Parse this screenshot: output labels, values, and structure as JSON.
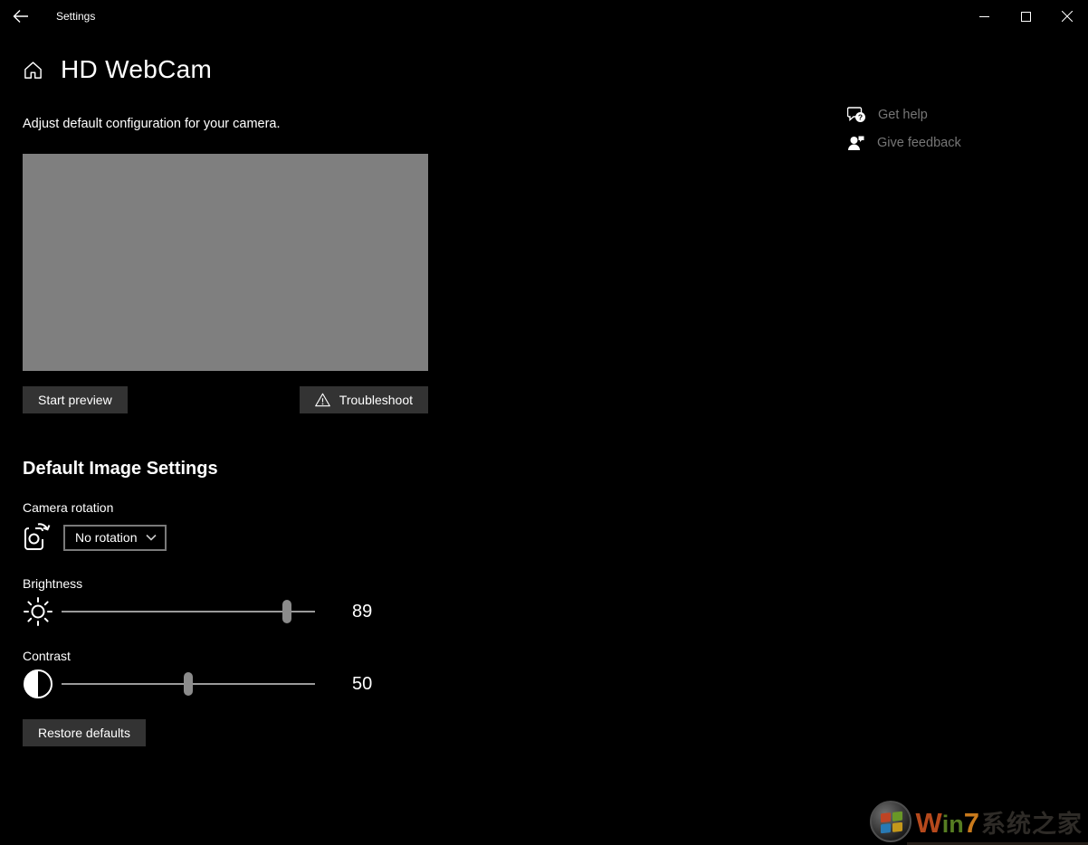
{
  "titlebar": {
    "app_title": "Settings"
  },
  "page": {
    "title": "HD WebCam",
    "subtitle": "Adjust default configuration for your camera."
  },
  "help": {
    "get_help": "Get help",
    "give_feedback": "Give feedback"
  },
  "preview": {
    "start_label": "Start preview",
    "troubleshoot_label": "Troubleshoot"
  },
  "image_settings": {
    "section_title": "Default Image Settings",
    "rotation_label": "Camera rotation",
    "rotation_value": "No rotation",
    "brightness": {
      "label": "Brightness",
      "value": 89,
      "min": 0,
      "max": 100
    },
    "contrast": {
      "label": "Contrast",
      "value": 50,
      "min": 0,
      "max": 100
    },
    "restore_label": "Restore defaults"
  },
  "watermark": {
    "w": "W",
    "in": "in",
    "seven": "7",
    "cn": "系统之家"
  },
  "colors": {
    "background": "#000000",
    "preview_gray": "#7f7f7f",
    "button_bg": "#333333",
    "muted_text": "#767676",
    "dropdown_border": "#7a7a7a",
    "slider_track": "#9a9a9a",
    "slider_thumb": "#8b8b8b"
  }
}
